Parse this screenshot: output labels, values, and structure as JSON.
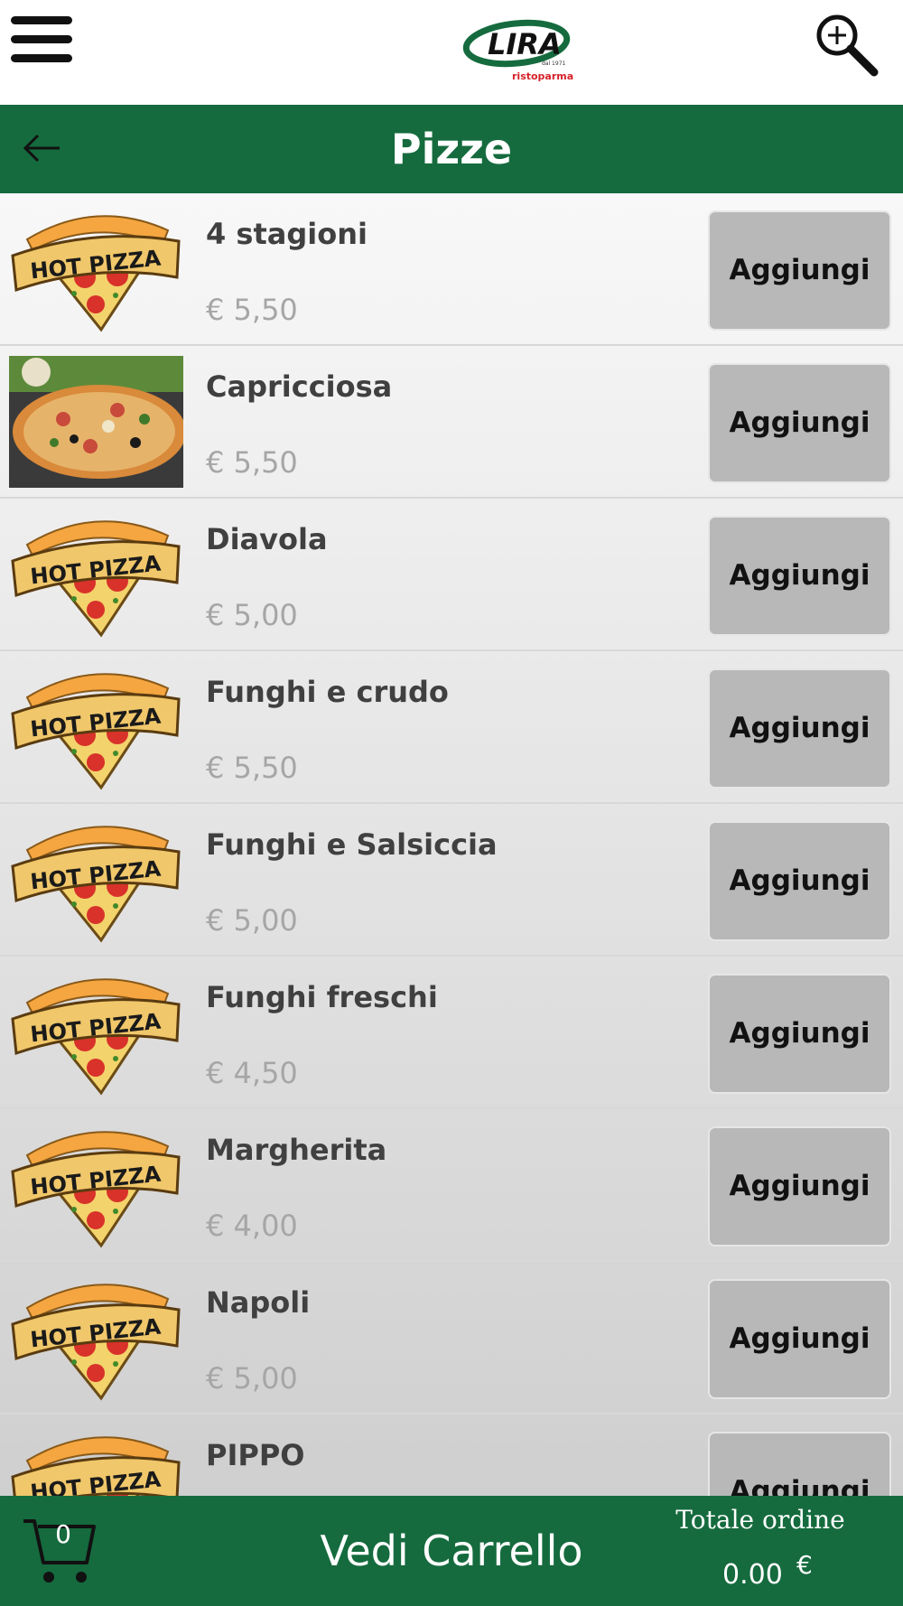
{
  "header": {
    "logo_text": "LIRA",
    "logo_since": "dal 1971",
    "logo_sub": "ristoparma"
  },
  "titlebar": {
    "title": "Pizze"
  },
  "items": [
    {
      "name": "4 stagioni",
      "price": "€ 5,50",
      "button": "Aggiungi",
      "image": "hot-pizza-logo"
    },
    {
      "name": "Capricciosa",
      "price": "€ 5,50",
      "button": "Aggiungi",
      "image": "pizza-photo"
    },
    {
      "name": "Diavola",
      "price": "€ 5,00",
      "button": "Aggiungi",
      "image": "hot-pizza-logo"
    },
    {
      "name": "Funghi e crudo",
      "price": "€ 5,50",
      "button": "Aggiungi",
      "image": "hot-pizza-logo"
    },
    {
      "name": "Funghi e Salsiccia",
      "price": "€ 5,00",
      "button": "Aggiungi",
      "image": "hot-pizza-logo"
    },
    {
      "name": "Funghi freschi",
      "price": "€ 4,50",
      "button": "Aggiungi",
      "image": "hot-pizza-logo"
    },
    {
      "name": "Margherita",
      "price": "€ 4,00",
      "button": "Aggiungi",
      "image": "hot-pizza-logo"
    },
    {
      "name": "Napoli",
      "price": "€ 5,00",
      "button": "Aggiungi",
      "image": "hot-pizza-logo"
    },
    {
      "name": "PIPPO",
      "price": "",
      "button": "Aggiungi",
      "image": "hot-pizza-logo"
    }
  ],
  "hot_pizza_text": "HOT PIZZA",
  "bottom": {
    "cart_count": "0",
    "view_cart": "Vedi Carrello",
    "total_label": "Totale ordine",
    "total_value": "0.00",
    "currency": "€"
  },
  "colors": {
    "brand_green": "#156b3e",
    "button_gray": "#b8b8b8"
  }
}
